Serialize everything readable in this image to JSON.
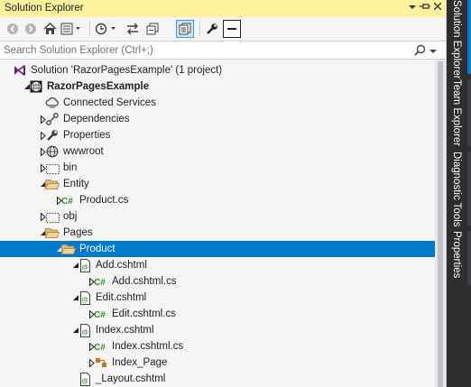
{
  "window": {
    "title": "Solution Explorer"
  },
  "titlebar_buttons": [
    "dropdown-icon",
    "pin-icon",
    "close-icon"
  ],
  "toolbar": {
    "icons": [
      "back-icon",
      "forward-icon",
      "home-icon",
      "switch-views-icon",
      "pending-changes-filter-icon",
      "sync-icon",
      "collapse-all-icon",
      "show-all-files-icon",
      "properties-wrench-icon",
      "preview-selected-icon"
    ]
  },
  "search": {
    "placeholder": "Search Solution Explorer (Ctrl+;)",
    "value": ""
  },
  "tree": [
    {
      "label": "Solution 'RazorPagesExample' (1 project)",
      "icon": "solution-icon",
      "expander": "none",
      "bold": false,
      "selected": false
    },
    {
      "label": "RazorPagesExample",
      "icon": "web-project-icon",
      "expander": "expanded",
      "bold": true,
      "selected": false
    },
    {
      "label": "Connected Services",
      "icon": "connected-services-icon",
      "expander": "none",
      "bold": false,
      "selected": false
    },
    {
      "label": "Dependencies",
      "icon": "dependencies-icon",
      "expander": "collapsed",
      "bold": false,
      "selected": false
    },
    {
      "label": "Properties",
      "icon": "wrench-icon",
      "expander": "collapsed",
      "bold": false,
      "selected": false
    },
    {
      "label": "wwwroot",
      "icon": "globe-icon",
      "expander": "collapsed",
      "bold": false,
      "selected": false
    },
    {
      "label": "bin",
      "icon": "hidden-folder-icon",
      "expander": "collapsed",
      "bold": false,
      "selected": false
    },
    {
      "label": "Entity",
      "icon": "folder-open-icon",
      "expander": "expanded",
      "bold": false,
      "selected": false
    },
    {
      "label": "Product.cs",
      "icon": "csharp-file-icon",
      "expander": "collapsed",
      "bold": false,
      "selected": false
    },
    {
      "label": "obj",
      "icon": "hidden-folder-icon",
      "expander": "collapsed",
      "bold": false,
      "selected": false
    },
    {
      "label": "Pages",
      "icon": "folder-open-icon",
      "expander": "expanded",
      "bold": false,
      "selected": false
    },
    {
      "label": "Product",
      "icon": "folder-open-icon",
      "expander": "expanded",
      "bold": false,
      "selected": true
    },
    {
      "label": "Add.cshtml",
      "icon": "razor-file-icon",
      "expander": "expanded",
      "bold": false,
      "selected": false
    },
    {
      "label": "Add.cshtml.cs",
      "icon": "csharp-file-icon",
      "expander": "collapsed",
      "bold": false,
      "selected": false
    },
    {
      "label": "Edit.cshtml",
      "icon": "razor-file-icon",
      "expander": "expanded",
      "bold": false,
      "selected": false
    },
    {
      "label": "Edit.cshtml.cs",
      "icon": "csharp-file-icon",
      "expander": "collapsed",
      "bold": false,
      "selected": false
    },
    {
      "label": "Index.cshtml",
      "icon": "razor-file-icon",
      "expander": "expanded",
      "bold": false,
      "selected": false
    },
    {
      "label": "Index.cshtml.cs",
      "icon": "csharp-file-icon",
      "expander": "collapsed",
      "bold": false,
      "selected": false
    },
    {
      "label": "Index_Page",
      "icon": "class-icon",
      "expander": "collapsed",
      "bold": false,
      "selected": false
    },
    {
      "label": "_Layout.cshtml",
      "icon": "razor-file-icon",
      "expander": "none",
      "bold": false,
      "selected": false
    }
  ],
  "side_tabs": [
    {
      "label": "Solution Explorer",
      "active": true
    },
    {
      "label": "Team Explorer",
      "active": false
    },
    {
      "label": "Diagnostic Tools",
      "active": false
    },
    {
      "label": "Properties",
      "active": false
    }
  ],
  "colors": {
    "title_active": "#fff29d",
    "selection": "#007acc",
    "panel_bg": "#f5f5f5",
    "chrome_dark": "#2d2d30"
  }
}
